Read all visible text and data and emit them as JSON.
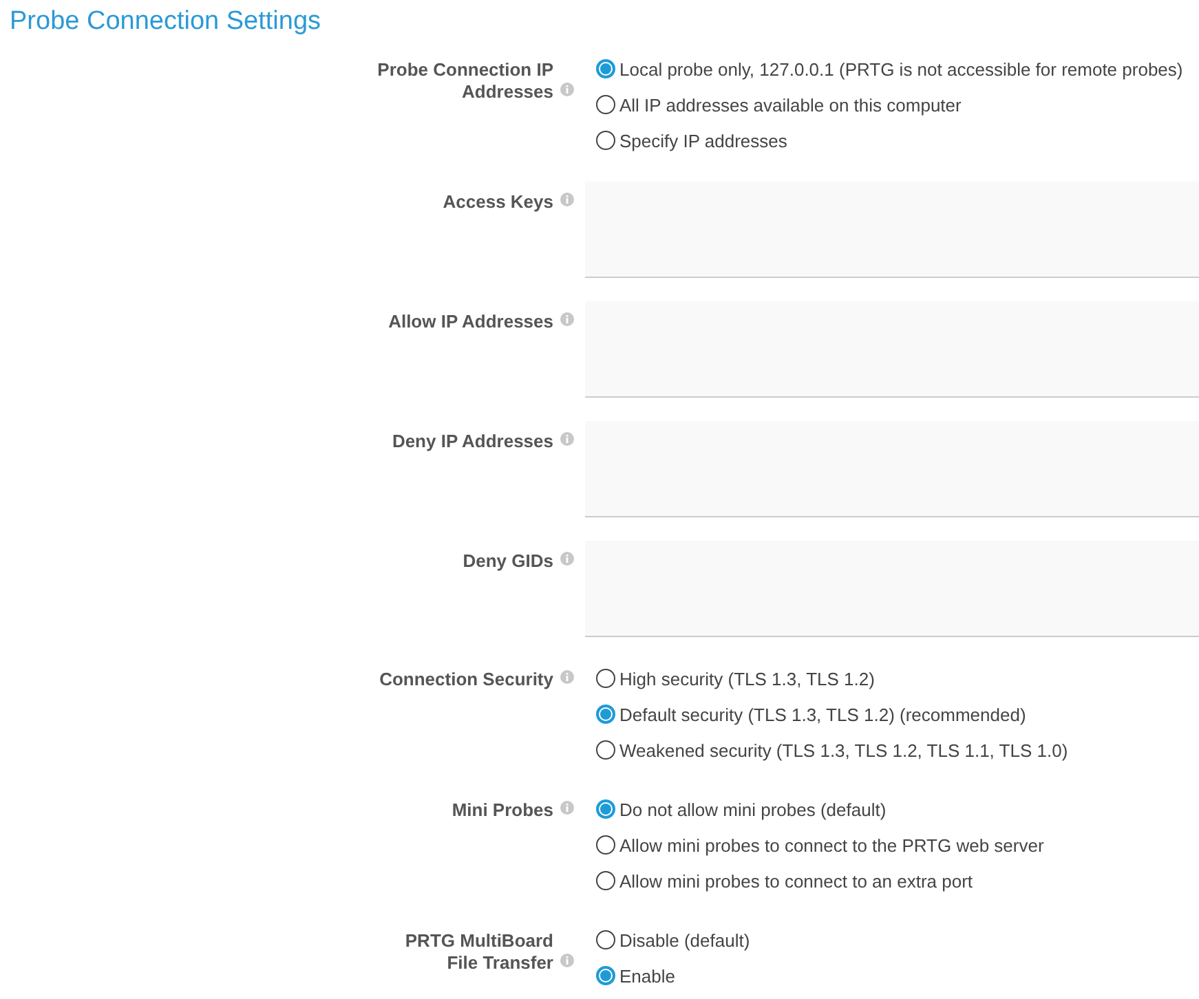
{
  "title": "Probe Connection Settings",
  "settings": [
    {
      "kind": "radio",
      "label": "Probe Connection IP Addresses",
      "options": [
        {
          "label": "Local probe only, 127.0.0.1 (PRTG is not accessible for remote probes)",
          "selected": true
        },
        {
          "label": "All IP addresses available on this computer",
          "selected": false
        },
        {
          "label": "Specify IP addresses",
          "selected": false
        }
      ]
    },
    {
      "kind": "textarea",
      "label": "Access Keys"
    },
    {
      "kind": "textarea",
      "label": "Allow IP Addresses"
    },
    {
      "kind": "textarea",
      "label": "Deny IP Addresses"
    },
    {
      "kind": "textarea",
      "label": "Deny GIDs"
    },
    {
      "kind": "radio",
      "label": "Connection Security",
      "options": [
        {
          "label": "High security (TLS 1.3, TLS 1.2)",
          "selected": false
        },
        {
          "label": "Default security (TLS 1.3, TLS 1.2) (recommended)",
          "selected": true
        },
        {
          "label": "Weakened security (TLS 1.3, TLS 1.2, TLS 1.1, TLS 1.0)",
          "selected": false
        }
      ]
    },
    {
      "kind": "radio",
      "label": "Mini Probes",
      "options": [
        {
          "label": "Do not allow mini probes (default)",
          "selected": true
        },
        {
          "label": "Allow mini probes to connect to the PRTG web server",
          "selected": false
        },
        {
          "label": "Allow mini probes to connect to an extra port",
          "selected": false
        }
      ]
    },
    {
      "kind": "radio",
      "label": "PRTG MultiBoard File Transfer",
      "options": [
        {
          "label": "Disable (default)",
          "selected": false
        },
        {
          "label": "Enable",
          "selected": true
        }
      ]
    }
  ]
}
